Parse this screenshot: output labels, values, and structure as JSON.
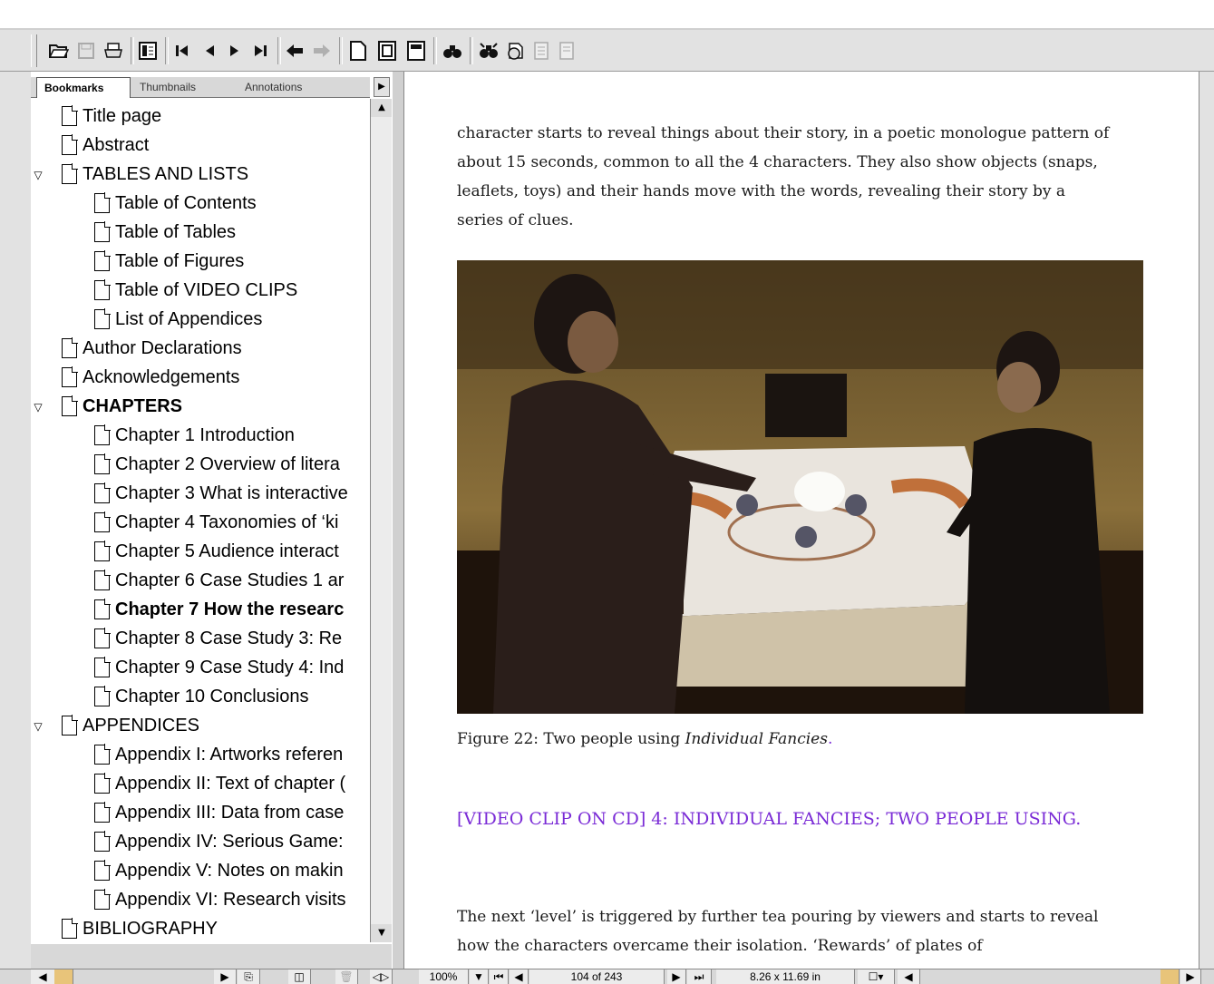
{
  "toolbar": {
    "icons": [
      "open-icon",
      "save-icon",
      "print-icon",
      "navigation-pane-icon",
      "first-page-icon",
      "previous-page-icon",
      "next-page-icon",
      "last-page-icon",
      "go-back-icon",
      "go-forward-icon",
      "actual-size-icon",
      "fit-page-icon",
      "fit-width-icon",
      "find-icon",
      "search-icon",
      "web-capture-icon",
      "page-icon",
      "page-icon-2"
    ]
  },
  "tabs": {
    "bookmarks": "Bookmarks",
    "thumbnails": "Thumbnails",
    "annotations": "Annotations"
  },
  "bookmarks": [
    {
      "label": "Title page",
      "level": 0
    },
    {
      "label": "Abstract",
      "level": 0
    },
    {
      "label": "TABLES AND LISTS",
      "level": 0,
      "expanded": true
    },
    {
      "label": "Table of Contents",
      "level": 1
    },
    {
      "label": "Table of Tables",
      "level": 1
    },
    {
      "label": "Table of Figures",
      "level": 1
    },
    {
      "label": "Table of VIDEO CLIPS",
      "level": 1
    },
    {
      "label": "List of Appendices",
      "level": 1
    },
    {
      "label": "Author Declarations",
      "level": 0
    },
    {
      "label": "Acknowledgements",
      "level": 0
    },
    {
      "label": "CHAPTERS",
      "level": 0,
      "expanded": true,
      "bold": true
    },
    {
      "label": "Chapter 1 Introduction",
      "level": 1
    },
    {
      "label": "Chapter 2 Overview of litera",
      "level": 1
    },
    {
      "label": "Chapter 3 What is interactive",
      "level": 1
    },
    {
      "label": "Chapter 4 Taxonomies of ‘ki",
      "level": 1
    },
    {
      "label": "Chapter 5 Audience interact",
      "level": 1
    },
    {
      "label": "Chapter 6 Case Studies 1 ar",
      "level": 1
    },
    {
      "label": "Chapter 7 How the researc",
      "level": 1,
      "bold": true
    },
    {
      "label": "Chapter 8 Case Study 3: Re",
      "level": 1
    },
    {
      "label": "Chapter 9 Case Study 4: Ind",
      "level": 1
    },
    {
      "label": "Chapter 10 Conclusions",
      "level": 1
    },
    {
      "label": "APPENDICES",
      "level": 0,
      "expanded": true
    },
    {
      "label": "Appendix I: Artworks referen",
      "level": 1
    },
    {
      "label": "Appendix II: Text of chapter (",
      "level": 1
    },
    {
      "label": "Appendix III: Data from case",
      "level": 1
    },
    {
      "label": "Appendix IV: Serious Game:",
      "level": 1
    },
    {
      "label": "Appendix V: Notes on makin",
      "level": 1
    },
    {
      "label": "Appendix VI: Research visits",
      "level": 1
    },
    {
      "label": "BIBLIOGRAPHY",
      "level": 0
    }
  ],
  "document": {
    "para1": "character starts to reveal things about their story, in a poetic monologue pattern of about 15 seconds, common to all the 4 characters. They also show objects (snaps, leaflets, toys) and their hands move with the words, revealing their story by a series of clues.",
    "caption_prefix": "Figure 22: Two people using ",
    "caption_title": "Individual Fancies",
    "caption_suffix": ".",
    "video_heading": "[VIDEO CLIP ON CD] 4: INDIVIDUAL FANCIES; TWO PEOPLE USING.",
    "para2": "The next ‘level’ is triggered by further tea pouring by viewers and starts to reveal how the characters overcame their isolation. ‘Rewards’ of plates of"
  },
  "statusbar": {
    "zoom": "100%",
    "page_indicator": "104 of 243",
    "page_size": "8.26 x 11.69 in"
  },
  "colors": {
    "video_heading": "#7a2bd6",
    "toolbar_bg": "#e2e2e2"
  }
}
